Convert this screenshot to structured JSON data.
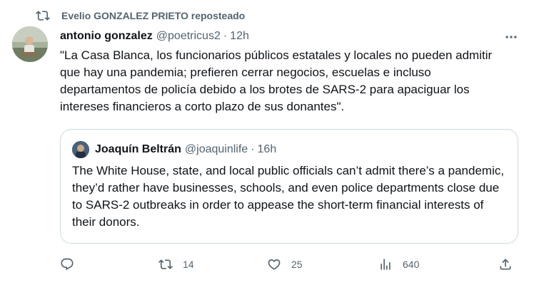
{
  "repost": {
    "label": "Evelio GONZALEZ PRIETO reposteado",
    "icon": "repost-icon"
  },
  "tweet": {
    "author_name": "antonio gonzalez",
    "author_handle": "@poetricus2",
    "separator": "·",
    "time": "12h",
    "text": "\"La Casa Blanca, los funcionarios públicos estatales y locales no pueden admitir que hay una pandemia; prefieren cerrar negocios, escuelas e incluso departamentos de policía debido a los brotes de SARS-2 para apaciguar los intereses financieros a corto plazo de sus donantes\".",
    "more_icon": "more-icon"
  },
  "quote": {
    "author_name": "Joaquín Beltrán",
    "author_handle": "@joaquinlife",
    "separator": "·",
    "time": "16h",
    "text": "The White House, state, and local public officials can’t admit there’s a pandemic, they’d rather have businesses, schools, and even police departments close due to SARS-2 outbreaks in order to appease the short-term financial interests of their donors."
  },
  "actions": {
    "reply": {
      "icon": "reply-icon",
      "count": ""
    },
    "repost": {
      "icon": "repost-icon",
      "count": "14"
    },
    "like": {
      "icon": "heart-icon",
      "count": "25"
    },
    "views": {
      "icon": "views-icon",
      "count": "640"
    },
    "share": {
      "icon": "share-icon",
      "count": ""
    }
  },
  "colors": {
    "text": "#0f1419",
    "secondary": "#536471",
    "border": "#cfd9de"
  }
}
